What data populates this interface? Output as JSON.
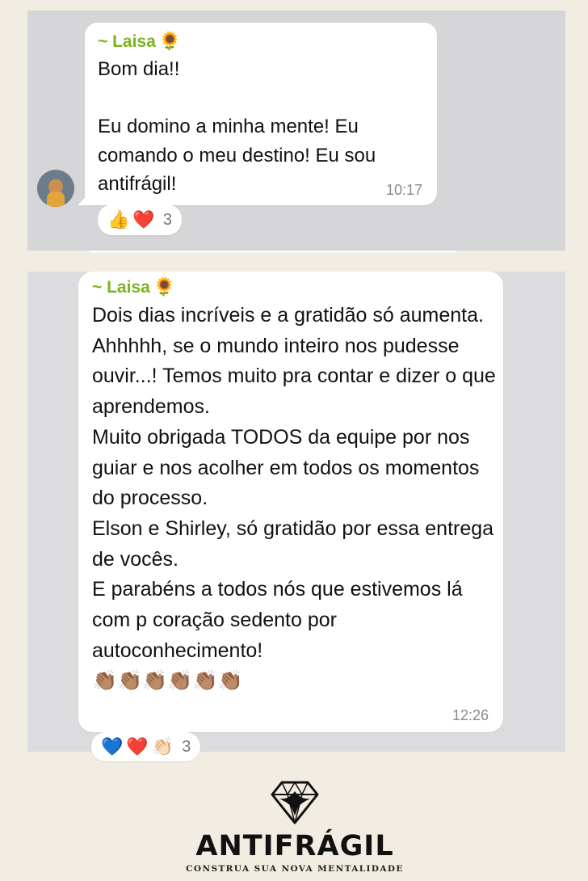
{
  "messages": [
    {
      "sender": "~ Laisa",
      "sender_emoji": "🌻",
      "text": "Bom dia!!\n\nEu domino a minha mente! Eu comando o meu destino! Eu sou antifrágil!",
      "time": "10:17",
      "reactions": {
        "emojis": [
          "👍",
          "❤️"
        ],
        "count": "3"
      }
    },
    {
      "sender": "~ Laisa",
      "sender_emoji": "🌻",
      "text": "Dois dias incríveis e a gratidão só aumenta.\nAhhhhh, se o mundo inteiro nos pudesse ouvir...! Temos muito pra contar e dizer o que aprendemos.\nMuito obrigada TODOS da equipe por nos guiar e nos acolher em todos os momentos do processo.\nElson e Shirley, só gratidão por essa entrega de vocês.\nE parabéns a todos nós que estivemos lá com p coração sedento por autoconhecimento!\n👏🏽👏🏽👏🏽👏🏽👏🏽👏🏽",
      "time": "12:26",
      "reactions": {
        "emojis": [
          "💙",
          "❤️",
          "👏🏻"
        ],
        "count": "3"
      }
    }
  ],
  "brand": {
    "name": "ANTIFRÁGIL",
    "tagline": "CONSTRUA SUA NOVA MENTALIDADE",
    "logo_icon": "diamond-phoenix-icon"
  },
  "colors": {
    "sender": "#7ab51d",
    "bubble": "#ffffff",
    "panel": "#d6d6d8",
    "page": "#f2ede3"
  }
}
